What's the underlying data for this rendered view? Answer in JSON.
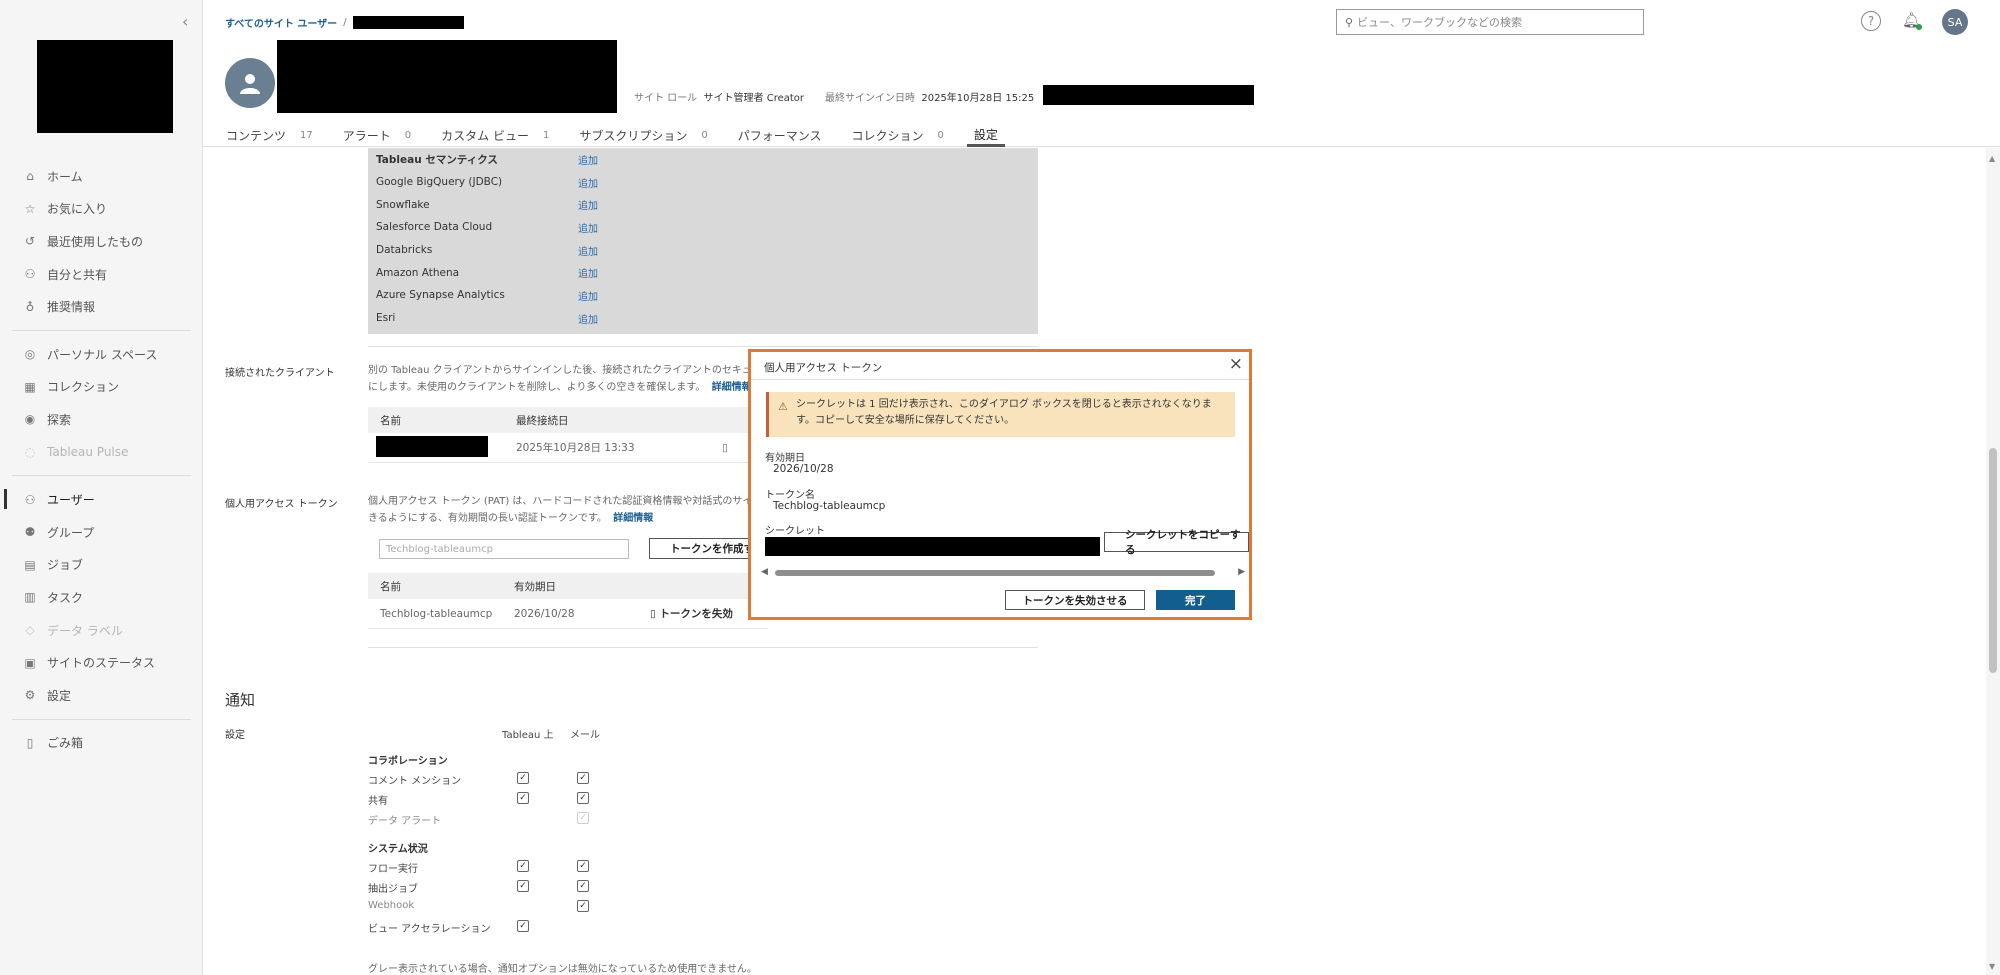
{
  "sidebar": {
    "items": [
      {
        "label": "ホーム",
        "icon": "home-icon",
        "glyph": "⌂"
      },
      {
        "label": "お気に入り",
        "icon": "star-icon",
        "glyph": "☆"
      },
      {
        "label": "最近使用したもの",
        "icon": "recent-icon",
        "glyph": "↺"
      },
      {
        "label": "自分と共有",
        "icon": "shared-icon",
        "glyph": "⚇"
      },
      {
        "label": "推奨情報",
        "icon": "bulb-icon",
        "glyph": "♁"
      },
      {
        "label": "パーソナル スペース",
        "icon": "personal-space-icon",
        "glyph": "◎"
      },
      {
        "label": "コレクション",
        "icon": "collection-icon",
        "glyph": "▦"
      },
      {
        "label": "探索",
        "icon": "explore-icon",
        "glyph": "◉"
      },
      {
        "label": "Tableau Pulse",
        "icon": "pulse-icon",
        "glyph": "◌"
      },
      {
        "label": "ユーザー",
        "icon": "users-icon",
        "glyph": "⚇"
      },
      {
        "label": "グループ",
        "icon": "groups-icon",
        "glyph": "⚉"
      },
      {
        "label": "ジョブ",
        "icon": "jobs-icon",
        "glyph": "▤"
      },
      {
        "label": "タスク",
        "icon": "tasks-icon",
        "glyph": "▥"
      },
      {
        "label": "データ ラベル",
        "icon": "data-label-icon",
        "glyph": "◇"
      },
      {
        "label": "サイトのステータス",
        "icon": "site-status-icon",
        "glyph": "▣"
      },
      {
        "label": "設定",
        "icon": "settings-icon",
        "glyph": "⚙"
      },
      {
        "label": "ごみ箱",
        "icon": "trash-icon",
        "glyph": "▯"
      }
    ]
  },
  "header": {
    "breadcrumb_root": "すべてのサイト ユーザー",
    "breadcrumb_sep": "/",
    "site_role_label": "サイト ロール",
    "site_role_value": "サイト管理者 Creator",
    "last_signin_label": "最終サインイン日時",
    "last_signin_value": "2025年10月28日 15:25",
    "search_placeholder": "ビュー、ワークブックなどの検索",
    "avatar_initials": "SA",
    "tabs": [
      {
        "label": "コンテンツ",
        "count": "17"
      },
      {
        "label": "アラート",
        "count": "0"
      },
      {
        "label": "カスタム ビュー",
        "count": "1"
      },
      {
        "label": "サブスクリプション",
        "count": "0"
      },
      {
        "label": "パフォーマンス",
        "count": ""
      },
      {
        "label": "コレクション",
        "count": "0"
      },
      {
        "label": "設定",
        "count": ""
      }
    ]
  },
  "connectors": {
    "rows": [
      {
        "name": "Tableau セマンティクス",
        "action": "追加"
      },
      {
        "name": "Google BigQuery (JDBC)",
        "action": "追加"
      },
      {
        "name": "Snowflake",
        "action": "追加"
      },
      {
        "name": "Salesforce Data Cloud",
        "action": "追加"
      },
      {
        "name": "Databricks",
        "action": "追加"
      },
      {
        "name": "Amazon Athena",
        "action": "追加"
      },
      {
        "name": "Azure Synapse Analytics",
        "action": "追加"
      },
      {
        "name": "Esri",
        "action": "追加"
      }
    ]
  },
  "connected_clients": {
    "label": "接続されたクライアント",
    "desc_line1": "別の Tableau クライアントからサインインした後、接続されたクライアントのセキュ",
    "desc_line2": "にします。未使用のクライアントを削除し、より多くの空きを確保します。",
    "more_link": "詳細情報",
    "col_name": "名前",
    "col_last": "最終接続日",
    "row_date": "2025年10月28日 13:33"
  },
  "pat": {
    "label": "個人用アクセス トークン",
    "desc_line1": "個人用アクセス トークン (PAT) は、ハードコードされた認証資格情報や対話式のサイ",
    "desc_line2": "きるようにする、有効期間の長い認証トークンです。",
    "more_link": "詳細情報",
    "input_placeholder": "Techblog-tableaumcp",
    "create_button": "トークンを作成す",
    "col_name": "名前",
    "col_expiry": "有効期日",
    "row_name": "Techblog-tableaumcp",
    "row_expiry": "2026/10/28",
    "revoke_partial": "トークンを失効"
  },
  "notifications": {
    "title": "通知",
    "settings_label": "設定",
    "col_tableau": "Tableau 上",
    "col_mail": "メール",
    "group1": "コラボレーション",
    "rows1": [
      {
        "label": "コメント メンション",
        "on_site": "✓",
        "mail": "✓"
      },
      {
        "label": "共有",
        "on_site": "✓",
        "mail": "✓"
      },
      {
        "label": "データ アラート",
        "on_site": "",
        "mail": "✓"
      }
    ],
    "group2": "システム状況",
    "rows2": [
      {
        "label": "フロー実行",
        "on_site": "✓",
        "mail": "✓"
      },
      {
        "label": "抽出ジョブ",
        "on_site": "✓",
        "mail": "✓"
      },
      {
        "label": "Webhook",
        "on_site": "",
        "mail": "✓"
      },
      {
        "label": "ビュー アクセラレーション",
        "on_site": "✓",
        "mail": ""
      }
    ],
    "footnote": "グレー表示されている場合、通知オプションは無効になっているため使用できません。"
  },
  "dialog": {
    "title": "個人用アクセス トークン",
    "warning_line1": "シークレットは 1 回だけ表示され、このダイアログ ボックスを閉じると表示されなくなりま",
    "warning_line2": "す。コピーして安全な場所に保存してください。",
    "expiry_label": "有効期日",
    "expiry_value": "2026/10/28",
    "token_name_label": "トークン名",
    "token_name_value": "Techblog-tableaumcp",
    "secret_label": "シークレット",
    "copy_button": "シークレットをコピーする",
    "revoke_button": "トークンを失効させる",
    "done_button": "完了",
    "accent_color": "#e07a33"
  }
}
